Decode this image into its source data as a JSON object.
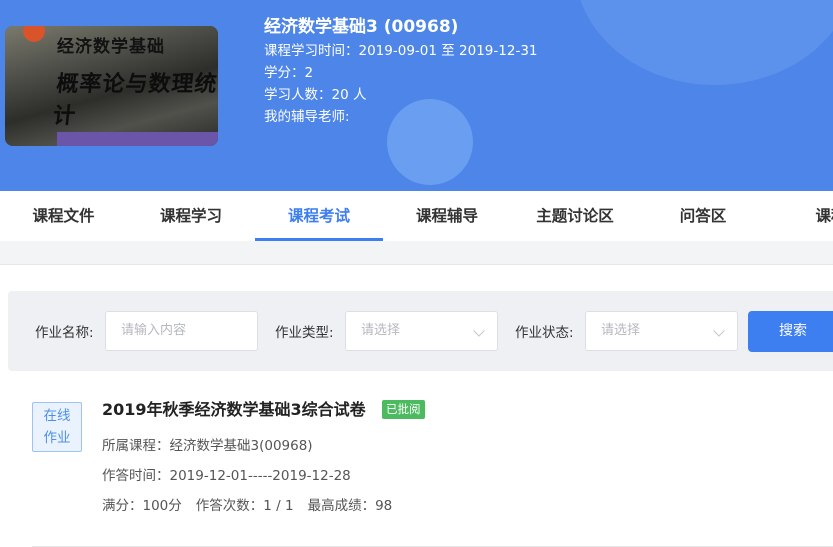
{
  "course": {
    "cover_line1": "经济数学基础",
    "cover_line2": "概率论与数理统计",
    "title": "经济数学基础3 (00968)",
    "study_time": "课程学习时间：2019-09-01 至 2019-12-31",
    "credits": "学分：2",
    "students": "学习人数：20 人",
    "tutor": "我的辅导老师:"
  },
  "tabs": [
    {
      "label": "课程文件"
    },
    {
      "label": "课程学习"
    },
    {
      "label": "课程考试"
    },
    {
      "label": "课程辅导"
    },
    {
      "label": "主题讨论区"
    },
    {
      "label": "问答区"
    },
    {
      "label": "课程"
    }
  ],
  "active_tab": "课程考试",
  "filter": {
    "name_label": "作业名称:",
    "name_placeholder": "请输入内容",
    "type_label": "作业类型:",
    "type_placeholder": "请选择",
    "status_label": "作业状态:",
    "status_placeholder": "请选择",
    "search_label": "搜索"
  },
  "assignment": {
    "type_line1": "在线",
    "type_line2": "作业",
    "title": "2019年秋季经济数学基础3综合试卷",
    "status": "已批阅",
    "course": "所属课程：经济数学基础3(00968)",
    "time": "作答时间：2019-12-01-----2019-12-28",
    "full_score": "满分：100分",
    "attempts": "作答次数：1 / 1",
    "best": "最高成绩：98"
  },
  "colors": {
    "brand": "#4d86e8",
    "accent": "#3d7ef0",
    "status_green": "#4cba5e"
  }
}
